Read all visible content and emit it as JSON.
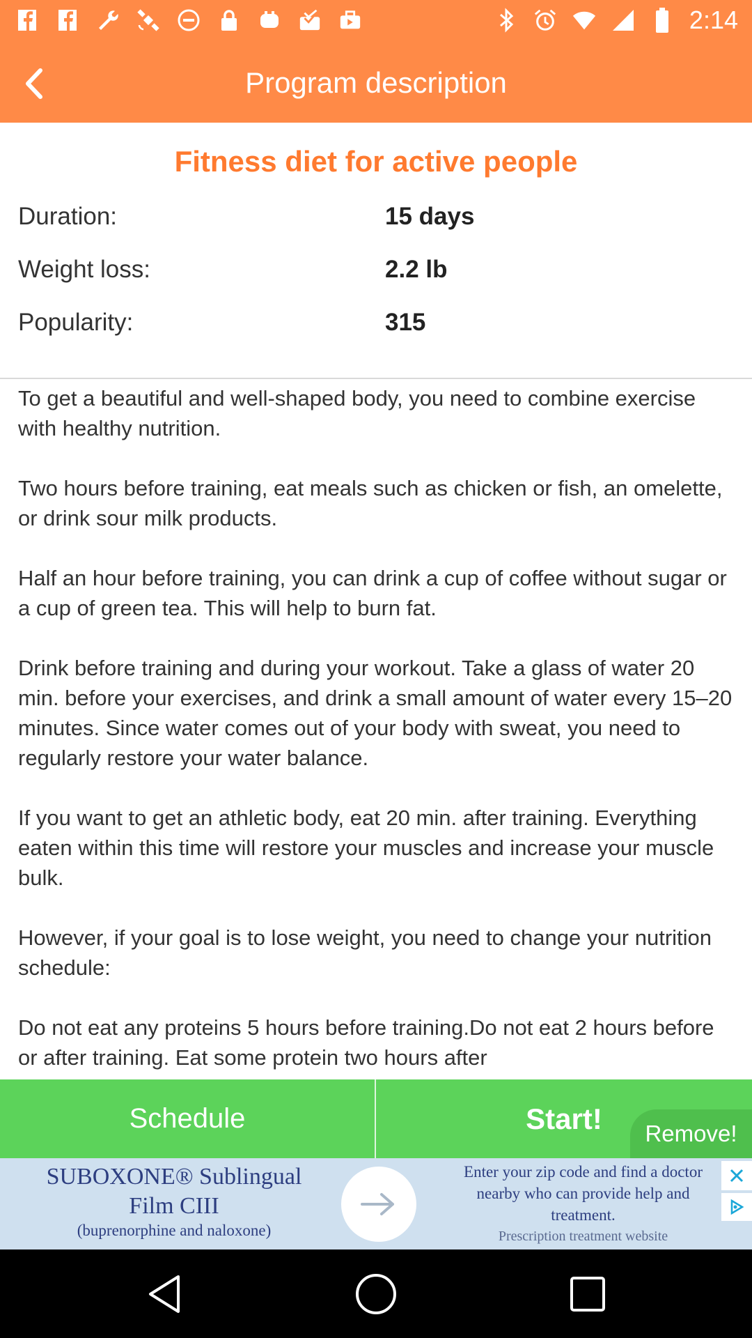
{
  "status_bar": {
    "time": "2:14",
    "left_icons": [
      "facebook-icon",
      "facebook-icon",
      "wrench-icon",
      "satellite-icon",
      "do-not-disturb-icon",
      "lock-icon",
      "game-controller-icon",
      "mail-tray-icon",
      "briefcase-icon"
    ],
    "right_icons": [
      "bluetooth-icon",
      "alarm-icon",
      "wifi-icon",
      "signal-icon",
      "battery-icon"
    ]
  },
  "app_bar": {
    "title": "Program description"
  },
  "program": {
    "title": "Fitness diet for active people",
    "stats": [
      {
        "label": "Duration:",
        "value": "15 days"
      },
      {
        "label": "Weight loss:",
        "value": "2.2 lb"
      },
      {
        "label": "Popularity:",
        "value": "315"
      }
    ],
    "description": "To get a beautiful and well-shaped body, you need to combine exercise with healthy nutrition.\n\nTwo hours before training, eat meals such as chicken or fish, an omelette, or drink sour milk products.\n\nHalf an hour before training, you can drink a cup of coffee without sugar or a cup of green tea. This will help to burn fat.\n\nDrink before training and during your workout. Take a glass of water 20 min. before your exercises, and drink a small amount of water every 15–20 minutes. Since water comes out of your body with sweat, you need to regularly restore your water balance.\n\nIf you want to get an athletic body, eat 20 min. after training. Everything eaten within this time will restore your muscles and increase your muscle bulk.\n\nHowever, if your goal is to lose weight, you need to change your nutrition schedule:\n\nDo not eat any proteins 5 hours before training.Do not eat 2 hours before or after training. Eat some protein two hours after"
  },
  "actions": {
    "schedule": "Schedule",
    "start": "Start!",
    "remove": "Remove!"
  },
  "ad": {
    "headline_1": "SUBOXONE® Sublingual",
    "headline_2": "Film CIII",
    "subline": "(buprenorphine and naloxone)",
    "right_text": "Enter your zip code and find a doctor nearby who can provide help and treatment.",
    "right_link": "Prescription treatment website"
  },
  "colors": {
    "accent": "#ff8a47",
    "title": "#ff7a2f",
    "green": "#5cd35a",
    "ad_bg": "#cfe0ef"
  }
}
